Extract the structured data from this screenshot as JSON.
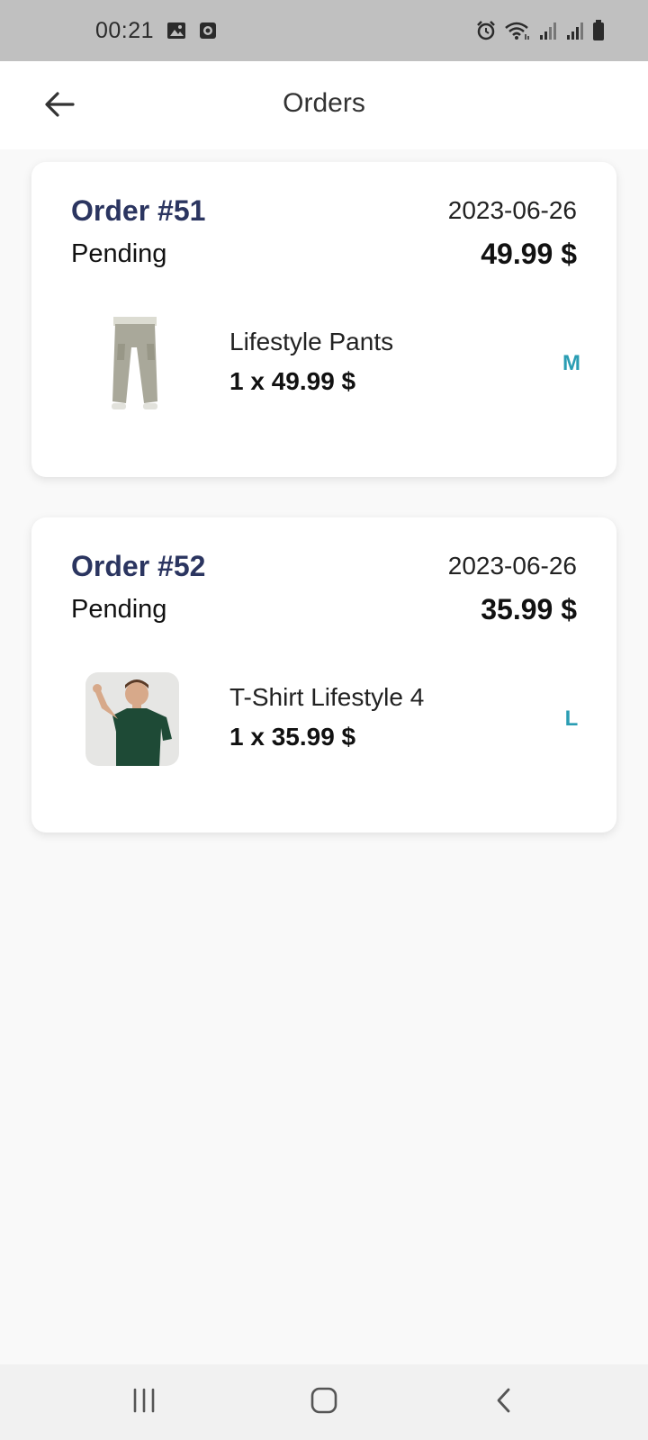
{
  "status_bar": {
    "time": "00:21",
    "icons": [
      "gallery-icon",
      "screen-record-icon",
      "alarm-icon",
      "wifi-icon",
      "signal-icon",
      "signal-icon",
      "battery-icon"
    ]
  },
  "app_bar": {
    "title": "Orders",
    "back_icon": "arrow-left-icon"
  },
  "orders": [
    {
      "number": "Order #51",
      "date": "2023-06-26",
      "status": "Pending",
      "total": "49.99 $",
      "items": [
        {
          "name": "Lifestyle Pants",
          "qty_price": "1 x 49.99 $",
          "size": "M",
          "image": "khaki-cargo-pants"
        }
      ]
    },
    {
      "number": "Order #52",
      "date": "2023-06-26",
      "status": "Pending",
      "total": "35.99 $",
      "items": [
        {
          "name": "T-Shirt Lifestyle 4",
          "qty_price": "1 x 35.99 $",
          "size": "L",
          "image": "man-in-green-tshirt"
        }
      ]
    }
  ],
  "nav_bar": {
    "icons": [
      "recent-apps-icon",
      "home-icon",
      "back-icon"
    ]
  },
  "colors": {
    "order_number": "#2b3560",
    "size_label": "#2a9db3",
    "status_bar_bg": "#c0c0c0",
    "page_bg": "#f9f9f9"
  }
}
